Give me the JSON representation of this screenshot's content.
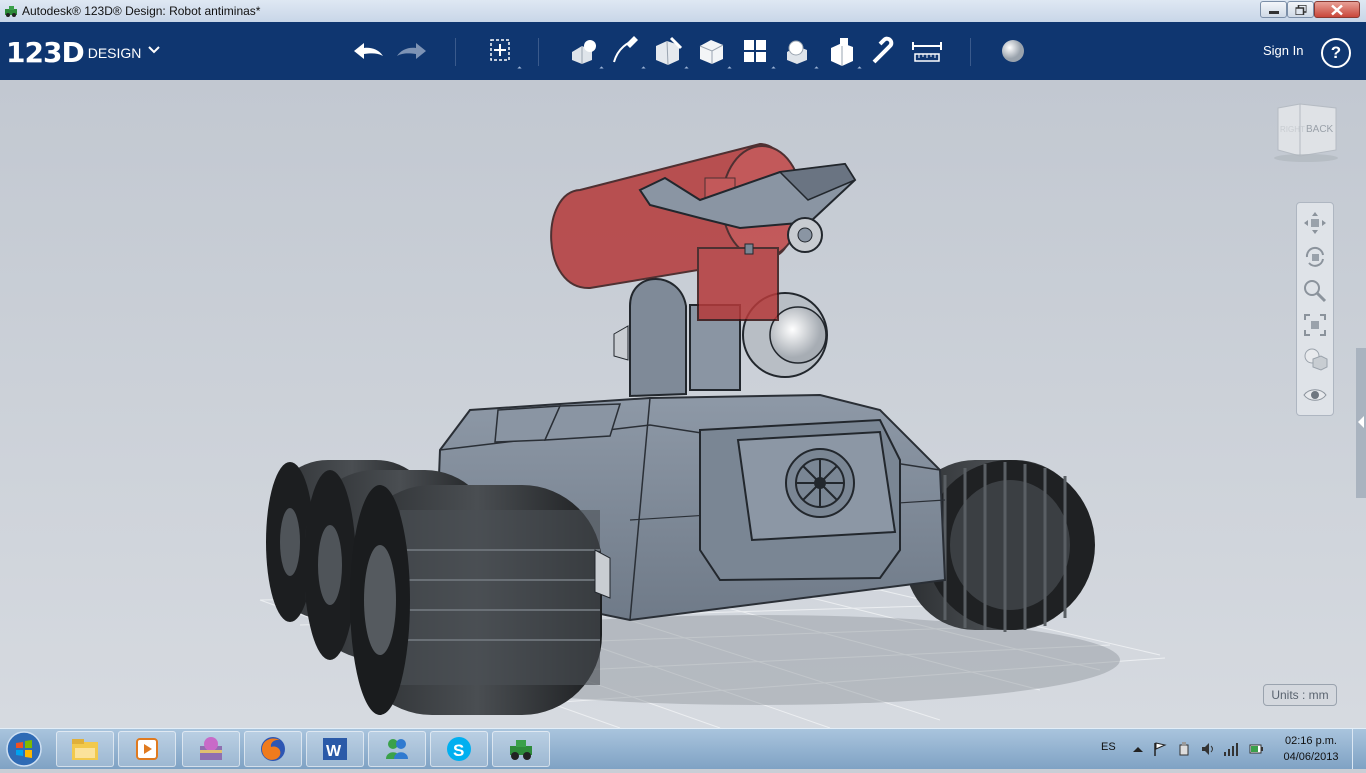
{
  "window": {
    "title": "Autodesk® 123D® Design: Robot antiminas*"
  },
  "app": {
    "logo_number": "123D",
    "logo_text": "DESIGN",
    "sign_in": "Sign In",
    "help": "?",
    "toolbar_icons": [
      "undo-icon",
      "redo-icon",
      "transform-icon",
      "primitives-icon",
      "sketch-icon",
      "construct-icon",
      "modify-icon",
      "pattern-icon",
      "grouping-icon",
      "combine-icon",
      "snap-icon",
      "measure-icon",
      "material-icon"
    ]
  },
  "viewport": {
    "viewcube_face_front": "RIGHT",
    "viewcube_face_side": "BACK",
    "units_label": "Units : mm",
    "nav_tools": [
      "pan-icon",
      "orbit-icon",
      "zoom-icon",
      "fit-icon",
      "view-mode-icon",
      "visibility-icon"
    ],
    "colors": {
      "body": "#7d8896",
      "tracks": "#1f2123",
      "red_parts": "#b53a3a"
    }
  },
  "taskbar": {
    "apps": [
      "explorer-icon",
      "media-player-icon",
      "winrar-icon",
      "firefox-icon",
      "word-icon",
      "messenger-icon",
      "skype-icon",
      "123d-icon"
    ],
    "language": "ES",
    "time": "02:16 p.m.",
    "date": "04/06/2013"
  }
}
